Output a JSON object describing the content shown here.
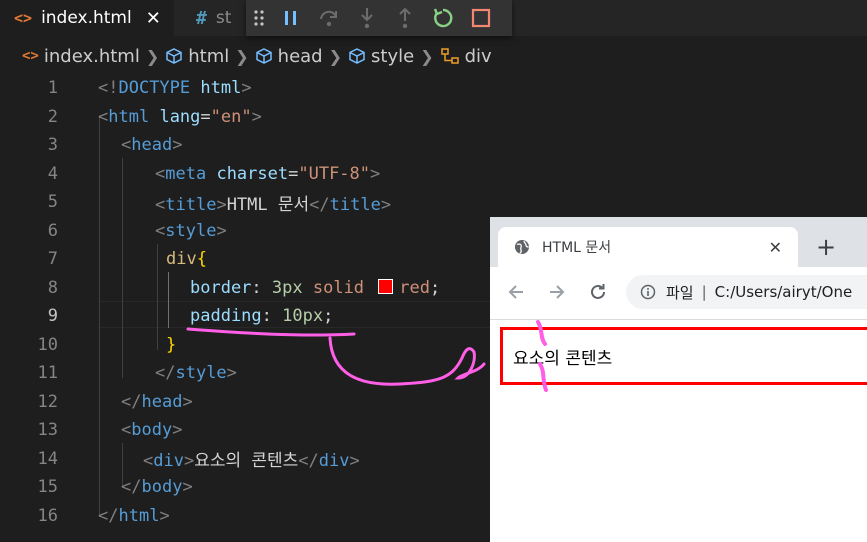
{
  "tabs": [
    {
      "icon": "<>",
      "label": "index.html",
      "close": "✕"
    },
    {
      "icon": "#",
      "label": "st"
    }
  ],
  "breadcrumb": [
    "index.html",
    "html",
    "head",
    "style",
    "div"
  ],
  "code": {
    "line_numbers": [
      "1",
      "2",
      "3",
      "4",
      "5",
      "6",
      "7",
      "8",
      "9",
      "10",
      "11",
      "12",
      "13",
      "14",
      "15",
      "16"
    ],
    "line1": {
      "open": "<!",
      "doctype": "DOCTYPE",
      "html": "html",
      "close": ">"
    },
    "line2": {
      "lt": "<",
      "tag": "html",
      "attr": "lang",
      "eq": "=",
      "val": "\"en\"",
      "gt": ">"
    },
    "line3": {
      "lt": "<",
      "tag": "head",
      "gt": ">"
    },
    "line4": {
      "lt": "<",
      "tag": "meta",
      "attr": "charset",
      "eq": "=",
      "val": "\"UTF-8\"",
      "gt": ">"
    },
    "line5": {
      "lt": "<",
      "tag": "title",
      "gt": ">",
      "text": "HTML 문서",
      "clt": "</",
      "ctag": "title",
      "cgt": ">"
    },
    "line6": {
      "lt": "<",
      "tag": "style",
      "gt": ">"
    },
    "line7": {
      "selector": "div",
      "brace": "{"
    },
    "line8": {
      "prop": "border",
      "colon": ": ",
      "num": "3px",
      "rest": " solid ",
      "color": "red",
      "semi": ";"
    },
    "line9": {
      "prop": "padding",
      "colon": ": ",
      "num": "10px",
      "semi": ";"
    },
    "line10": {
      "brace": "}"
    },
    "line11": {
      "clt": "</",
      "tag": "style",
      "gt": ">"
    },
    "line12": {
      "clt": "</",
      "tag": "head",
      "gt": ">"
    },
    "line13": {
      "lt": "<",
      "tag": "body",
      "gt": ">"
    },
    "line14": {
      "lt": "<",
      "tag": "div",
      "gt": ">",
      "text": "요소의 콘텐츠",
      "clt": "</",
      "ctag": "div",
      "cgt": ">"
    },
    "line15": {
      "clt": "</",
      "tag": "body",
      "gt": ">"
    },
    "line16": {
      "clt": "</",
      "tag": "html",
      "gt": ">"
    }
  },
  "browser": {
    "tab_title": "HTML 문서",
    "tab_close": "✕",
    "new_tab": "+",
    "address_scheme": "파일",
    "address_separator": "|",
    "address_url": "C:/Users/airyt/One",
    "page_content": "요소의 콘텐츠",
    "content_border_color": "#ff0000"
  },
  "icons": {
    "debug_toolbar": [
      "grip-icon",
      "pause-icon",
      "step-over-icon",
      "step-into-icon",
      "step-out-icon",
      "restart-icon",
      "stop-icon"
    ],
    "browser": [
      "globe-icon",
      "back-arrow-icon",
      "forward-arrow-icon",
      "reload-icon",
      "info-icon"
    ]
  },
  "colors": {
    "editor_bg": "#1e1e1e",
    "tag": "#569cd6",
    "attribute": "#9cdcfe",
    "string": "#ce9178",
    "selector": "#d7ba7d",
    "number": "#b5cea8",
    "annotation_ink": "#ff5ee6"
  }
}
